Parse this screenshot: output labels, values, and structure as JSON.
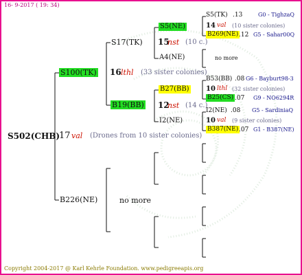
{
  "header": "16- 9-2017 ( 19: 34)",
  "footer": "Copyright 2004-2017 @ Karl Kehrle Foundation.   www.pedigreeapis.org",
  "root": {
    "label": "S502(CHB)",
    "number": "17",
    "marker": "val",
    "note": "(Drones from 10 sister colonies)"
  },
  "gen1": {
    "top": {
      "label": "S100(TK)",
      "number": "16",
      "marker": "lthl",
      "note": "(33 sister colonies)"
    },
    "bottom": {
      "label": "B226(NE)",
      "note": "no more"
    }
  },
  "gen2": {
    "a": {
      "label": "S17(TK)",
      "number": "15",
      "marker": "nst",
      "note": "(10 c.)"
    },
    "b": {
      "label": "B19(BB)",
      "number": "12",
      "marker": "nst",
      "note": "(14 c.)"
    }
  },
  "gen3": {
    "a1": {
      "label": "S5(NE)"
    },
    "a2": {
      "label": "A4(NE)",
      "note": "no more"
    },
    "b1": {
      "label": "B27(BB)"
    },
    "b2": {
      "label": "I2(NE)"
    }
  },
  "gen4": [
    {
      "label": "S5(TK)",
      "value": ".13",
      "ref": "G0 - TighzaQ"
    },
    {
      "number": "14",
      "marker": "val",
      "note": "(10 sister colonies)"
    },
    {
      "label": "B269(NE)",
      "value": ".12",
      "ref": "G5 - Sahar00Q"
    },
    {
      "label": "B53(BB)",
      "value": ".08",
      "ref": "G6 - Bayburt98-3"
    },
    {
      "number": "10",
      "marker": "lthl",
      "note": "(32 sister colonies)"
    },
    {
      "label": "B25(CS)",
      "value": ".07",
      "ref": "G9 - NO6294R"
    },
    {
      "label": "I2(NE)",
      "value": ".08",
      "ref": "G5 - SardiniaQ"
    },
    {
      "number": "10",
      "marker": "val",
      "note": "(9 sister colonies)"
    },
    {
      "label": "B387(NE)",
      "value": ".07",
      "ref": "G1 - B387(NE)"
    }
  ],
  "colors": {
    "frame": "#e8108f",
    "queen_box": "#22dd22",
    "drone_box": "#ffff00",
    "marker": "#cc1100",
    "ref": "#14148a"
  }
}
